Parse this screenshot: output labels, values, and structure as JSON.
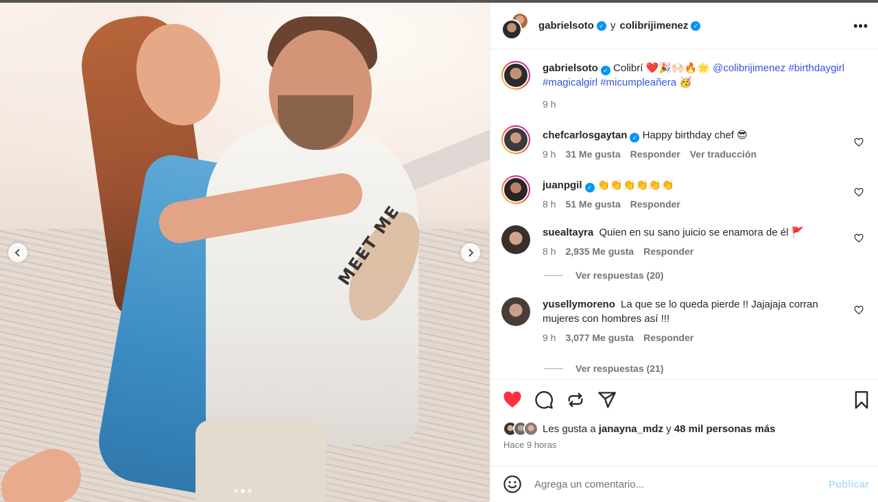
{
  "post": {
    "header": {
      "author": "gabrielsoto",
      "separator": "y",
      "collaborator": "colibrijimenez",
      "more_icon": "more-options-icon"
    },
    "media": {
      "shirt_print": "MEET ME",
      "slide_count": 3,
      "active_slide": 2
    },
    "caption": {
      "username": "gabrielsoto",
      "text": "Colibrí ❤️🎉🙌🏻🔥🌟",
      "mention": "@colibrijimenez",
      "hashtags_line1": "#birthdaygirl",
      "hashtags_line2": "#magicalgirl #micumpleañera",
      "emoji_end": "🥳",
      "time": "9 h"
    },
    "comments": [
      {
        "username": "chefcarlosgaytan",
        "verified": true,
        "text": "Happy birthday chef 😎",
        "time": "9 h",
        "likes": "31 Me gusta",
        "reply": "Responder",
        "translate": "Ver traducción",
        "avatar_color": "#3a3a3a"
      },
      {
        "username": "juanpgil",
        "verified": true,
        "text": "👏👏👏👏👏👏",
        "time": "8 h",
        "likes": "51 Me gusta",
        "reply": "Responder",
        "avatar_color": "#4a3b35"
      },
      {
        "username": "suealtayra",
        "verified": false,
        "text": "Quien en su sano juicio se enamora de él 🚩",
        "time": "8 h",
        "likes": "2,935 Me gusta",
        "reply": "Responder",
        "view_replies": "Ver respuestas (20)",
        "avatar_color": "#5a4a44"
      },
      {
        "username": "yusellymoreno",
        "verified": false,
        "text_line1": "La que se lo queda pierde !! Jajajaja corran",
        "text_line2": "mujeres con hombres así !!!",
        "time": "9 h",
        "likes": "3,077 Me gusta",
        "reply": "Responder",
        "view_replies": "Ver respuestas (21)",
        "avatar_color": "#6b5a52"
      }
    ],
    "actions": {
      "like": "heart-filled-icon",
      "comment": "comment-icon",
      "repost": "repost-icon",
      "share": "share-icon",
      "save": "bookmark-icon",
      "liked_color": "#ff3040"
    },
    "likes": {
      "prefix": "Les gusta a",
      "user": "janayna_mdz",
      "conj": "y",
      "others": "48 mil personas más"
    },
    "posted_ago": "Hace 9 horas",
    "add_comment": {
      "placeholder": "Agrega un comentario...",
      "publish": "Publicar"
    }
  }
}
